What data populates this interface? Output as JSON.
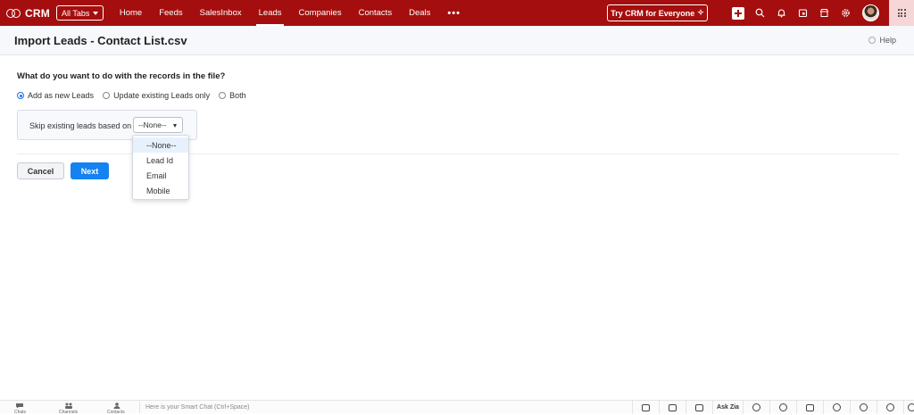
{
  "topbar": {
    "brand": "CRM",
    "all_tabs_label": "All Tabs",
    "nav": [
      {
        "label": "Home"
      },
      {
        "label": "Feeds"
      },
      {
        "label": "SalesInbox"
      },
      {
        "label": "Leads",
        "active": true
      },
      {
        "label": "Companies"
      },
      {
        "label": "Contacts"
      },
      {
        "label": "Deals"
      }
    ],
    "more_label": "•••",
    "try_crm_label": "Try CRM for Everyone",
    "try_crm_icon": "✧",
    "icons": [
      "add-icon",
      "search-icon",
      "bell-icon",
      "calendar-icon",
      "marketplace-icon",
      "gear-icon",
      "avatar",
      "apps-grid-icon"
    ],
    "colors": {
      "bar": "#a50e0e",
      "apps_box": "#f6d6d6"
    }
  },
  "page": {
    "title": "Import Leads - Contact List.csv",
    "help_label": "Help"
  },
  "form": {
    "question": "What do you want to do with the records in the file?",
    "options": [
      {
        "label": "Add as new Leads",
        "checked": true
      },
      {
        "label": "Update existing Leads only",
        "checked": false
      },
      {
        "label": "Both",
        "checked": false
      }
    ],
    "skip_label": "Skip existing leads based on",
    "skip_value": "--None--",
    "dropdown_options": [
      "--None--",
      "Lead Id",
      "Email",
      "Mobile"
    ],
    "dropdown_selected": "--None--",
    "cancel_label": "Cancel",
    "next_label": "Next",
    "colors": {
      "primary": "#1482f0",
      "radio": "#1a73e8"
    }
  },
  "bottombar": {
    "left_items": [
      {
        "label": "Chats",
        "icon": "chat-icon"
      },
      {
        "label": "Channels",
        "icon": "channels-icon"
      },
      {
        "label": "Contacts",
        "icon": "contacts-icon"
      }
    ],
    "chat_placeholder": "Here is your Smart Chat (Ctrl+Space)",
    "ask_zia": "Ask Zia"
  }
}
